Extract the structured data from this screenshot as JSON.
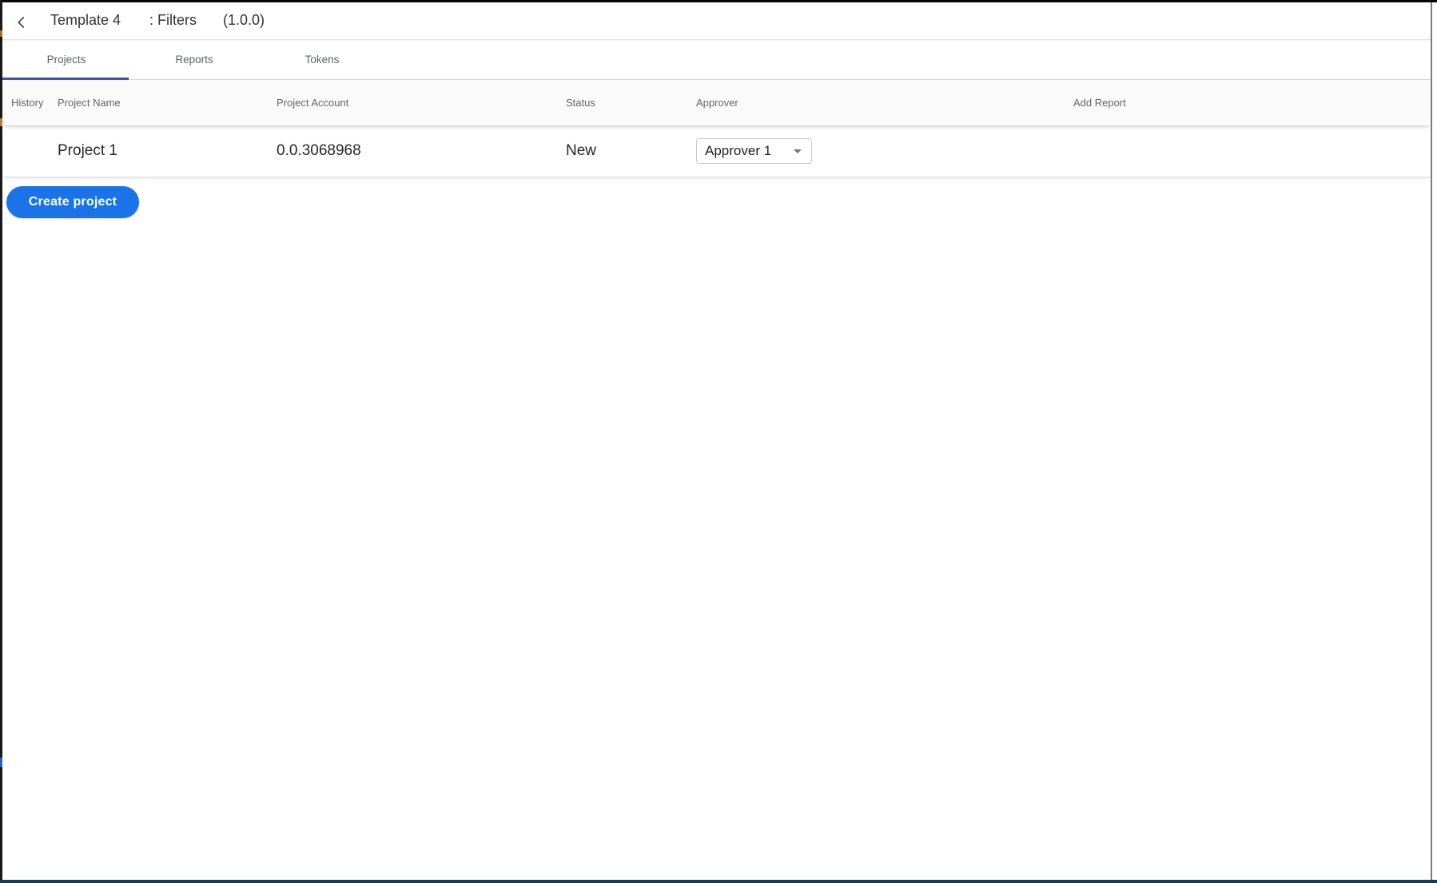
{
  "colors": {
    "tab_indicator": "#3f51b5",
    "primary_button": "#1a73e8",
    "bottom_edge_strip": "#1d3a52"
  },
  "app_bar": {
    "title": "Template 4",
    "separator": ": Filters",
    "version": "(1.0.0)"
  },
  "tabs": [
    {
      "label": "Projects",
      "active": true
    },
    {
      "label": "Reports",
      "active": false
    },
    {
      "label": "Tokens",
      "active": false
    }
  ],
  "table": {
    "columns": [
      "History",
      "Project Name",
      "Project Account",
      "Status",
      "Approver",
      "Add Report"
    ],
    "rows": [
      {
        "project_name": "Project 1",
        "project_account": "0.0.3068968",
        "status": "New",
        "approver_selected": "Approver 1"
      }
    ]
  },
  "buttons": {
    "create_project": "Create project"
  }
}
